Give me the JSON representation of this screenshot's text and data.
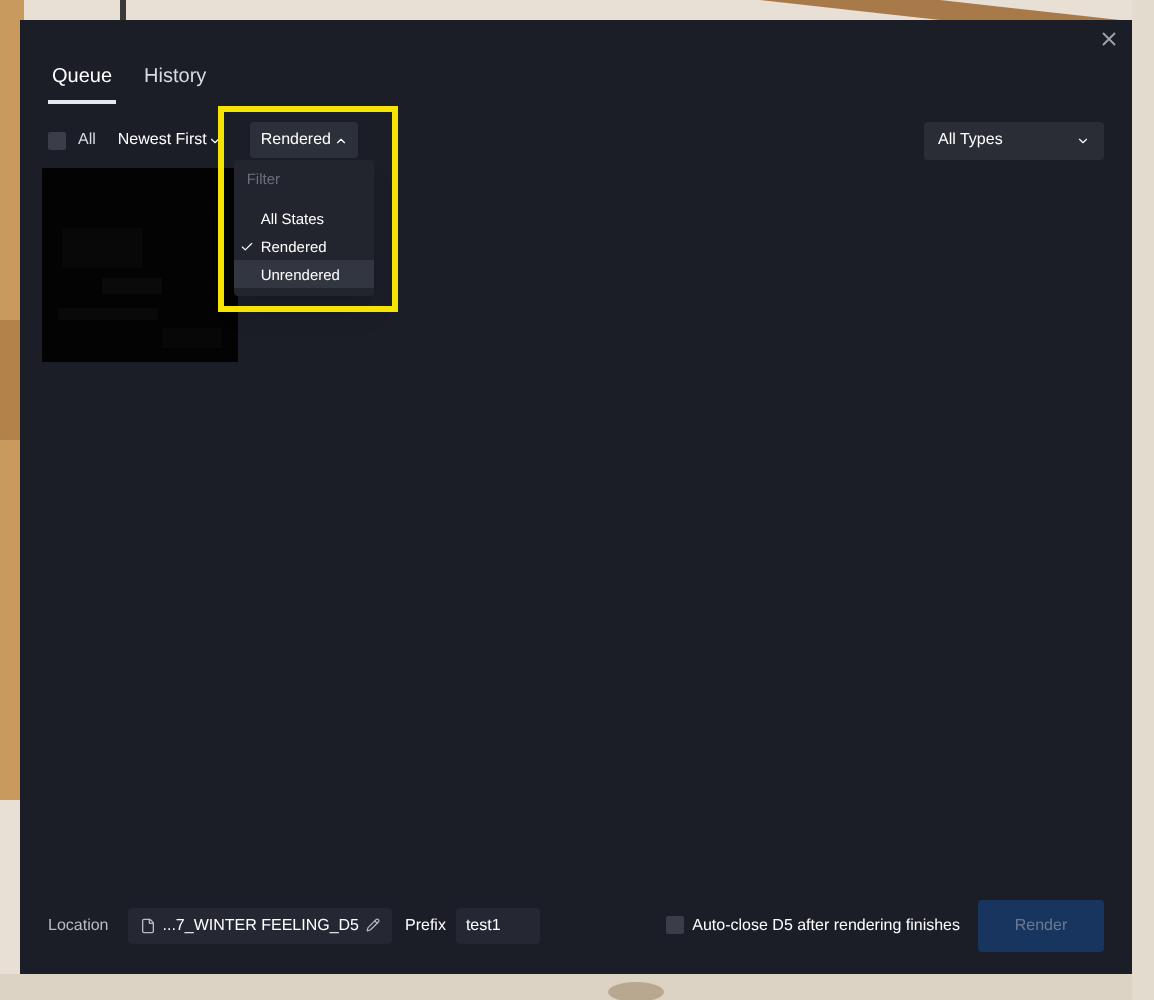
{
  "dialog": {
    "tabs": [
      {
        "label": "Queue",
        "selected": true
      },
      {
        "label": "History",
        "selected": false
      }
    ],
    "toolbar": {
      "select_all": {
        "label": "All",
        "checked": false
      },
      "sort": {
        "label": "Newest First"
      },
      "state_filter": {
        "label": "Rendered",
        "expanded": true
      },
      "type_filter": {
        "label": "All Types"
      }
    },
    "filter_menu": {
      "heading": "Filter",
      "items": [
        {
          "label": "All States",
          "selected": false,
          "hovered": false
        },
        {
          "label": "Rendered",
          "selected": true,
          "hovered": false
        },
        {
          "label": "Unrendered",
          "selected": false,
          "hovered": true
        }
      ]
    },
    "footer": {
      "location_label": "Location",
      "location_value": "...7_WINTER FEELING_D5",
      "prefix_label": "Prefix",
      "prefix_value": "test1",
      "auto_close": {
        "label": "Auto-close D5 after rendering finishes",
        "checked": false
      },
      "render_button": {
        "label": "Render",
        "disabled": true
      }
    }
  }
}
